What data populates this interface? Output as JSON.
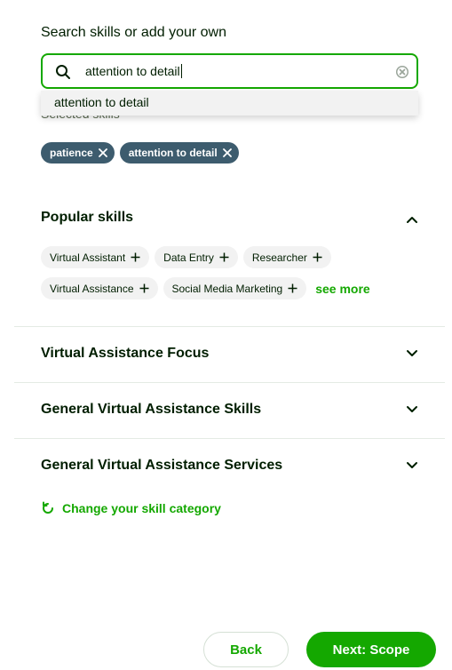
{
  "search": {
    "heading": "Search skills or add your own",
    "value": "attention to detail",
    "suggestion": "attention to detail"
  },
  "selected": {
    "label": "Selected skills",
    "chips": [
      "patience",
      "attention to detail"
    ]
  },
  "popular": {
    "title": "Popular skills",
    "row1": [
      "Virtual Assistant",
      "Data Entry",
      "Researcher"
    ],
    "row2": [
      "Virtual Assistance",
      "Social Media Marketing"
    ],
    "see_more": "see more"
  },
  "sections": [
    "Virtual Assistance Focus",
    "General Virtual Assistance Skills",
    "General Virtual Assistance Services"
  ],
  "change_category": "Change your skill category",
  "footer": {
    "back": "Back",
    "next": "Next: Scope"
  },
  "colors": {
    "accent": "#14a800",
    "chip_selected": "#3d5c6e",
    "chip_bg": "#f2f2f2"
  },
  "icons": [
    "search-icon",
    "clear-icon",
    "close-icon",
    "plus-icon",
    "chevron-up-icon",
    "chevron-down-icon",
    "refresh-icon"
  ]
}
